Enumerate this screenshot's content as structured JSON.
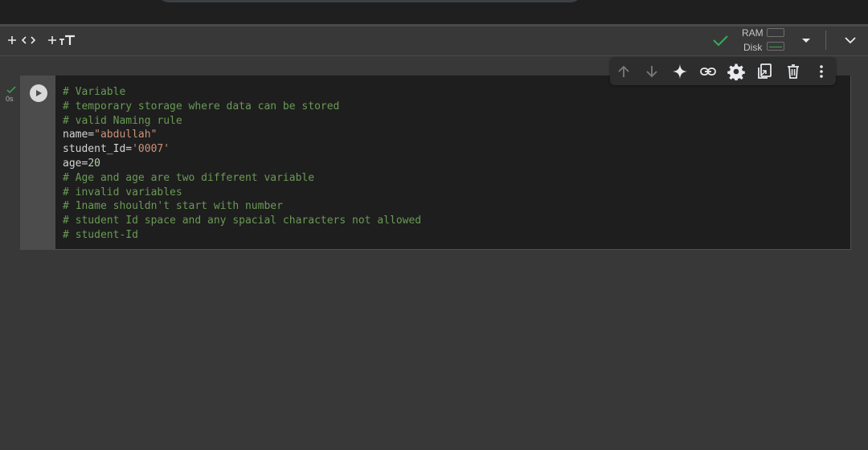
{
  "toolbar": {
    "add_code_label": "+ <>",
    "add_text_label": "+ тT",
    "ram_label": "RAM",
    "disk_label": "Disk"
  },
  "cell": {
    "exec_time": "0s",
    "code_lines": [
      "# Variable",
      "# temporary storage where data can be stored",
      "# valid Naming rule",
      "name=\"abdullah\"",
      "student_Id='0007'",
      "age=20",
      "# Age and age are two different variable",
      "# invalid variables",
      "# 1name shouldn't start with number",
      "# student Id space and any spacial characters not allowed",
      "# student-Id"
    ]
  },
  "cell_toolbar": {
    "icons": [
      "arrow-up-icon",
      "arrow-down-icon",
      "sparkle-icon",
      "link-icon",
      "gear-icon",
      "mirror-cell-icon",
      "trash-icon",
      "more-vert-icon"
    ]
  },
  "colors": {
    "comment": "#6a9955",
    "string": "#ce9178",
    "number": "#b5cea8",
    "connected_check": "#34a853"
  }
}
